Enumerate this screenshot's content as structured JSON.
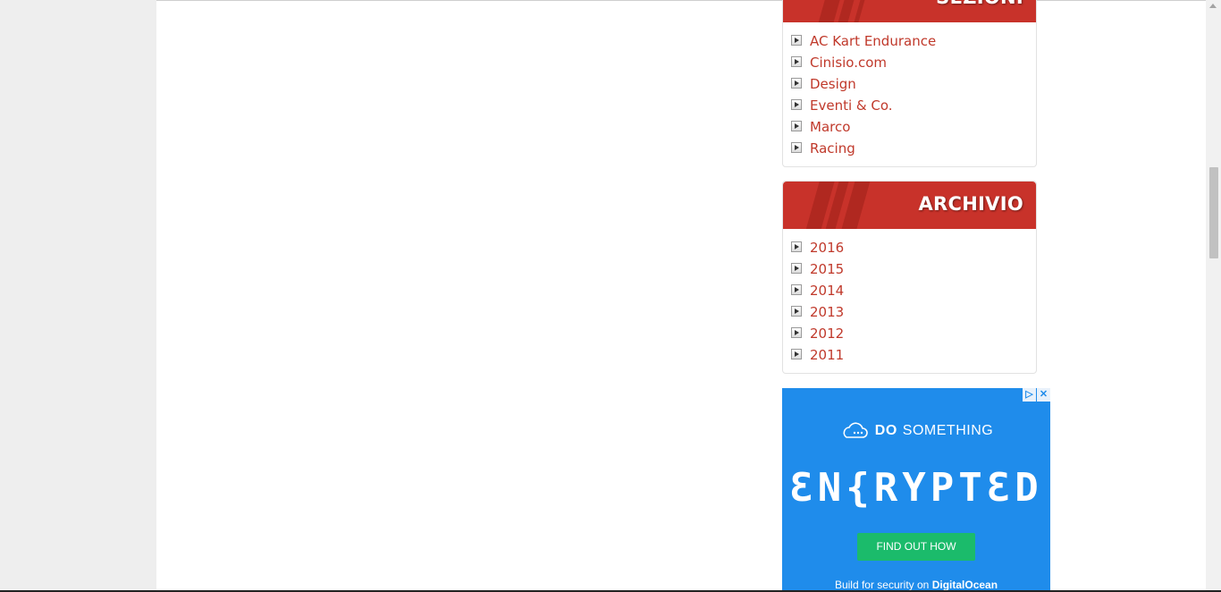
{
  "sidebar": {
    "sezioni": {
      "title": "SEZIONI",
      "items": [
        "AC Kart Endurance",
        "Cinisio.com",
        "Design",
        "Eventi & Co.",
        "Marco",
        "Racing"
      ]
    },
    "archivio": {
      "title": "ARCHIVIO",
      "items": [
        "2016",
        "2015",
        "2014",
        "2013",
        "2012",
        "2011"
      ]
    }
  },
  "ad": {
    "brand_cloud_icon": "cloud-icon",
    "headline_bold": "DO",
    "headline_rest": "SOMETHING",
    "big_text": "ƐN{RYPTƐD",
    "button_label": "FIND OUT HOW",
    "footer_text": "Build for security on",
    "footer_brand": "DigitalOcean",
    "adchoices_label": "▷",
    "close_label": "✕"
  },
  "colors": {
    "accent": "#c8322a",
    "link": "#c0392b",
    "ad_background": "#1f8ceb",
    "ad_button": "#1bbb6b"
  }
}
